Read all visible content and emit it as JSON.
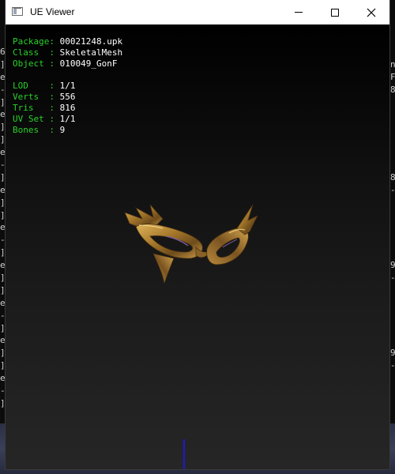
{
  "window": {
    "title": "UE Viewer",
    "controls": {
      "minimize_icon": "minimize-icon",
      "maximize_icon": "maximize-icon",
      "close_icon": "close-icon",
      "close_glyph": "✕"
    }
  },
  "viewer": {
    "package_info": [
      {
        "key": "Package",
        "sep": ": ",
        "value": "00021248.upk"
      },
      {
        "key": "Class  ",
        "sep": ": ",
        "value": "SkeletalMesh"
      },
      {
        "key": "Object ",
        "sep": ": ",
        "value": "010049_GonF"
      }
    ],
    "mesh_stats": [
      {
        "key": "LOD    ",
        "sep": ": ",
        "value": "1/1"
      },
      {
        "key": "Verts  ",
        "sep": ": ",
        "value": "556"
      },
      {
        "key": "Tris   ",
        "sep": ": ",
        "value": "816"
      },
      {
        "key": "UV Set ",
        "sep": ": ",
        "value": "1/1"
      },
      {
        "key": "Bones  ",
        "sep": ": ",
        "value": "9"
      }
    ],
    "colors": {
      "label": "#29d129",
      "value": "#ffffff",
      "axis": "#1b1bd8",
      "mesh_gold": "#b58a3a"
    }
  },
  "background_console": {
    "left_chars": [
      "6",
      "]",
      "e",
      "-",
      "]",
      "e",
      "]",
      "]",
      "e",
      "-",
      "]",
      "e",
      "]",
      "]",
      "e",
      "-",
      "]",
      "e",
      "]",
      "]",
      "e",
      "-",
      "]",
      "e",
      "]",
      "]",
      "e",
      "-",
      "]"
    ],
    "right_chars": [
      "",
      "n",
      "F",
      "8",
      "",
      "",
      "",
      "",
      "",
      "",
      "8",
      "-",
      "",
      "",
      "",
      "",
      "",
      "9",
      "-",
      "",
      "",
      "",
      "",
      "",
      "9",
      "-"
    ]
  }
}
